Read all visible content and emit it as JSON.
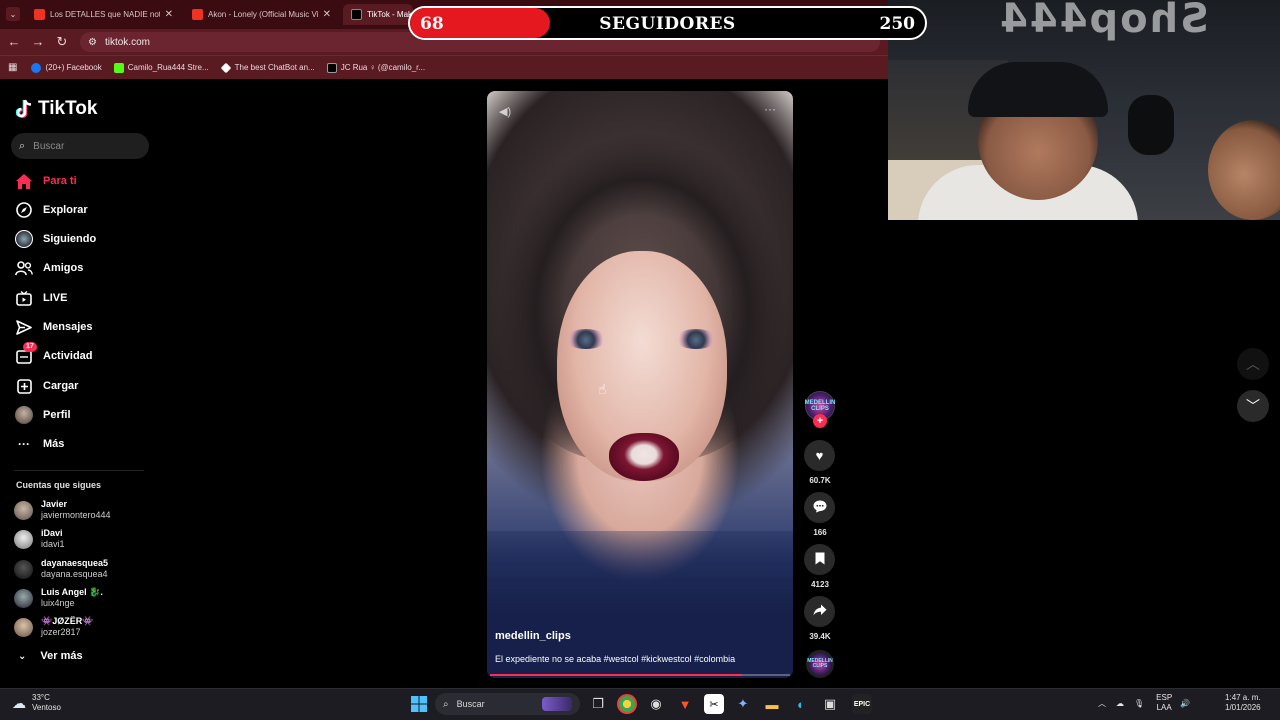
{
  "browser": {
    "tabs": [
      {
        "title": "Los DETALLES que NADIE notó",
        "favicon_color": "#e62117"
      },
      {
        "title": "Akon - Lonely (Official Music Vi",
        "favicon_color": "#e62117"
      },
      {
        "title": "TikTok - Mak",
        "favicon_color": "#000000"
      }
    ],
    "url": "tiktok.com",
    "bookmarks": [
      {
        "label": "(20+) Facebook",
        "color": "#1877f2"
      },
      {
        "label": "Camilo_Rua444 Stre...",
        "color": "#53fc18"
      },
      {
        "label": "The best ChatBot an...",
        "color": "#ffffff"
      },
      {
        "label": "JC Rua ♀ (@camilo_r...",
        "color": "#000000"
      }
    ]
  },
  "overlay": {
    "current": "68",
    "label": "SEGUIDORES",
    "goal": "250",
    "progress": 0.272,
    "wall_text": "Shop444"
  },
  "tiktok": {
    "logo": "TikTok",
    "search_placeholder": "Buscar",
    "nav": [
      {
        "label": "Para ti",
        "icon": "home-icon",
        "active": true
      },
      {
        "label": "Explorar",
        "icon": "compass-icon"
      },
      {
        "label": "Siguiendo",
        "icon": "following-avatar-icon"
      },
      {
        "label": "Amigos",
        "icon": "friends-icon"
      },
      {
        "label": "LIVE",
        "icon": "live-icon"
      },
      {
        "label": "Mensajes",
        "icon": "messages-icon"
      },
      {
        "label": "Actividad",
        "icon": "activity-icon",
        "badge": "17"
      },
      {
        "label": "Cargar",
        "icon": "upload-icon"
      },
      {
        "label": "Perfil",
        "icon": "profile-avatar-icon"
      },
      {
        "label": "Más",
        "icon": "more-dots-icon"
      }
    ],
    "following_title": "Cuentas que sigues",
    "accounts": [
      {
        "name": "Javier",
        "handle": "javiermontero444"
      },
      {
        "name": "iDavi",
        "handle": "idavi1"
      },
      {
        "name": "dayanaesquea5",
        "handle": "dayana.esquea4"
      },
      {
        "name": "Luis Angel 🐉.",
        "handle": "luix4nge"
      },
      {
        "name": "👾JØZËR👾",
        "handle": "jozer2817"
      }
    ],
    "see_more": "Ver más"
  },
  "video": {
    "author": "medellin_clips",
    "caption": "El expediente no se acaba #westcol #kickwestcol #colombia",
    "progress": 0.84,
    "creator_badge": "MEDELLIN CLIPS",
    "actions": [
      {
        "name": "like",
        "icon": "heart-icon",
        "count": "60.7K"
      },
      {
        "name": "comment",
        "icon": "comment-icon",
        "count": "166"
      },
      {
        "name": "save",
        "icon": "bookmark-icon",
        "count": "4123"
      },
      {
        "name": "share",
        "icon": "share-icon",
        "count": "39.4K"
      }
    ]
  },
  "taskbar": {
    "weather_temp": "33°C",
    "weather_desc": "Ventoso",
    "search_placeholder": "Buscar",
    "lang_top": "ESP",
    "lang_bottom": "LAA",
    "time": "1:47 a. m.",
    "date": "1/01/2026"
  }
}
